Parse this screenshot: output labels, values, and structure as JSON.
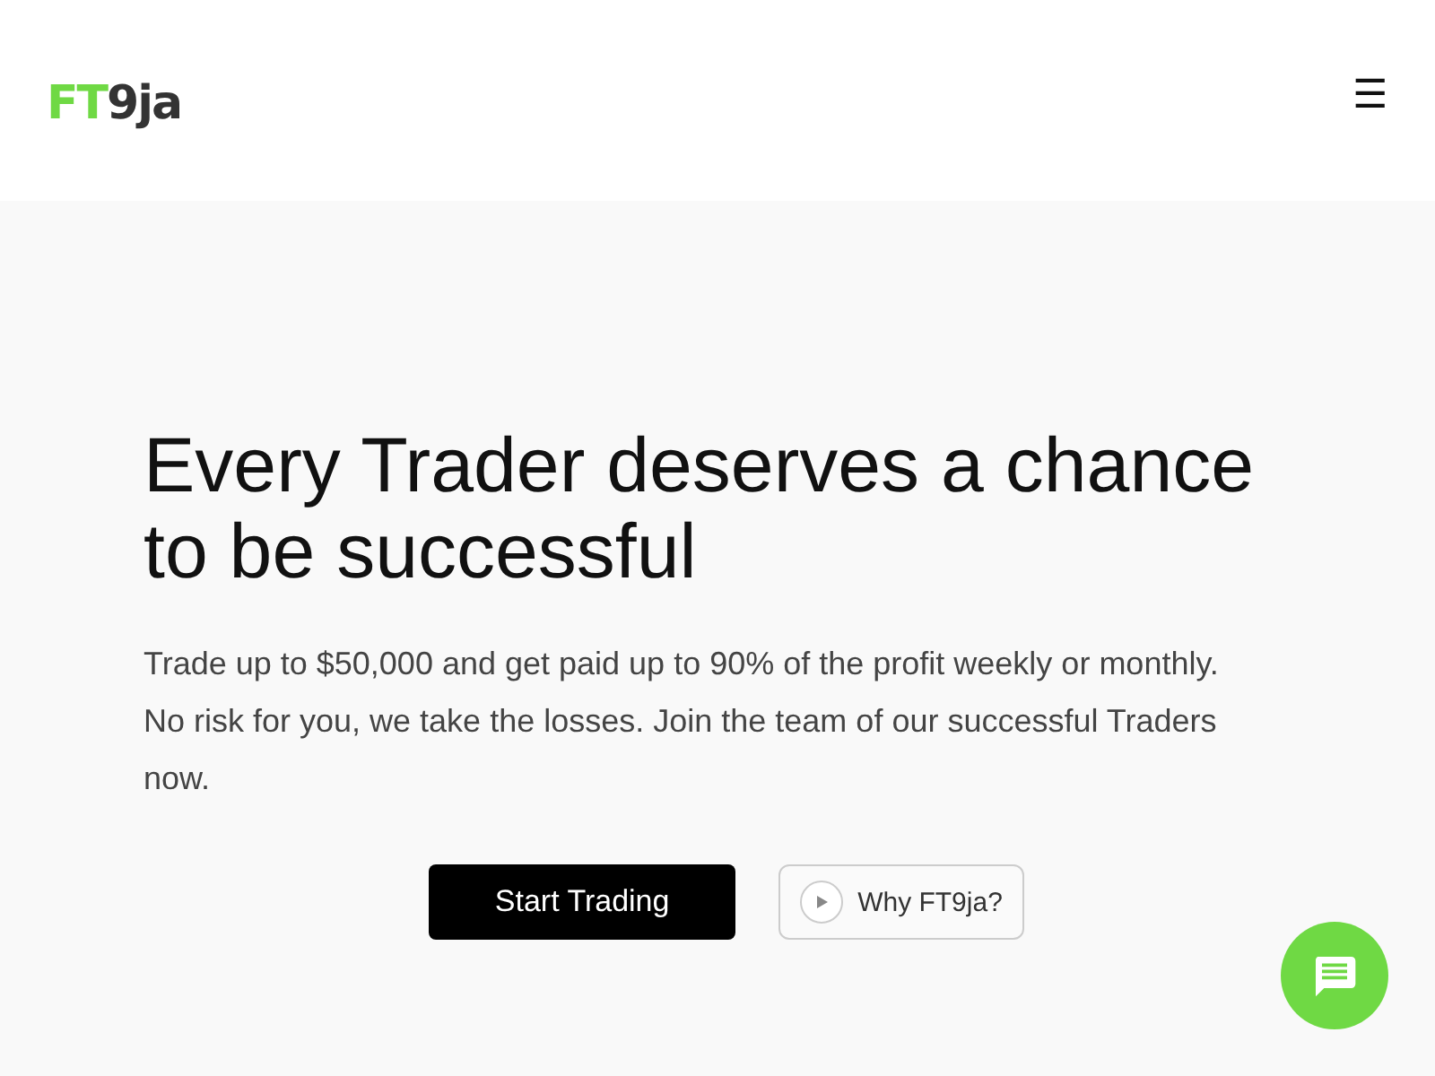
{
  "header": {
    "logo": {
      "accent": "FT",
      "rest": "9ja"
    },
    "menu_icon": "☰"
  },
  "hero": {
    "heading": "Every Trader deserves a chance to be successful",
    "text": "Trade up to $50,000 and get paid up to 90% of the profit weekly or monthly. No risk for you, we take the losses. Join the team of our successful Traders now.",
    "buttons": [
      {
        "label": "Start Trading",
        "kind": "primary"
      },
      {
        "label": "Why FT9ja?",
        "kind": "video"
      }
    ]
  },
  "chat_button": {
    "kind": "chat"
  }
}
